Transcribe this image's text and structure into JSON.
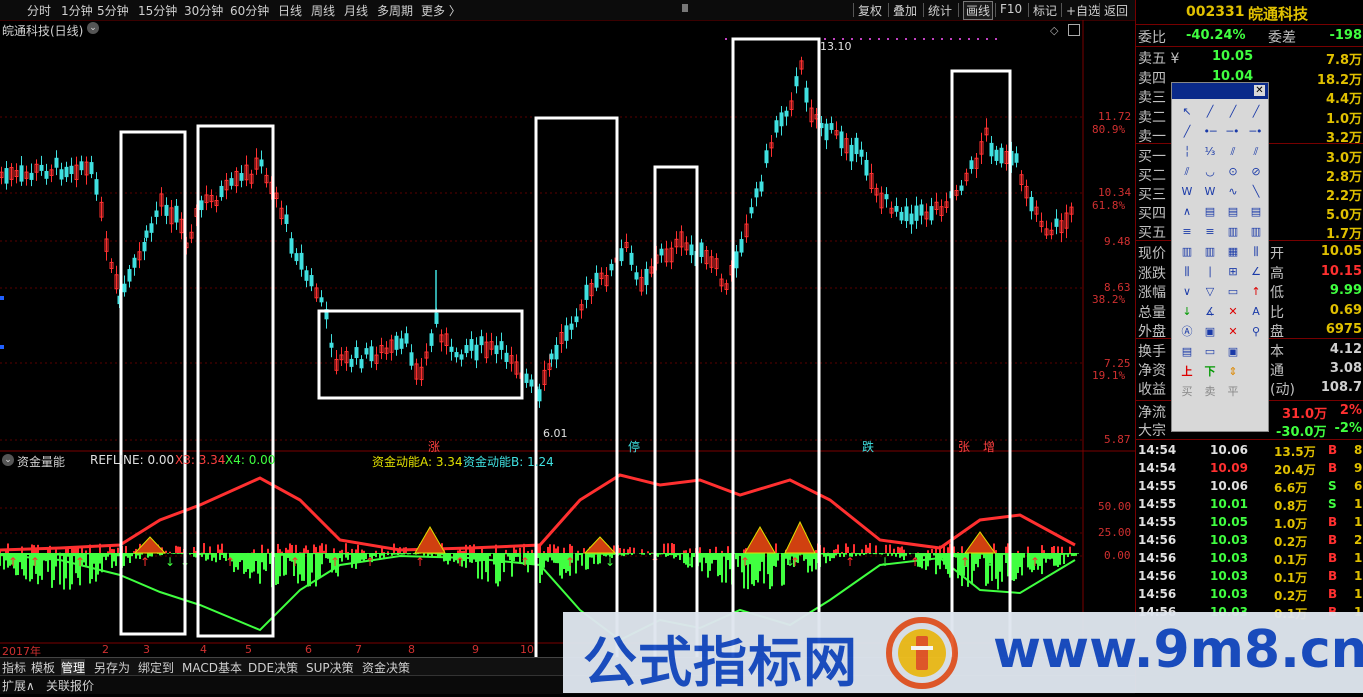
{
  "menu": {
    "left_items": [
      "分时",
      "1分钟",
      "5分钟",
      "15分钟",
      "30分钟",
      "60分钟",
      "日线",
      "周线",
      "月线",
      "多周期",
      "更多 〉"
    ],
    "right_items": [
      "复权",
      "叠加",
      "统计",
      "画线",
      "F10",
      "标记",
      "+自选",
      "返回"
    ]
  },
  "chart": {
    "title": "皖通科技(日线)",
    "price_axis": [
      "11.72",
      "10.34",
      "9.48",
      "8.63",
      "7.25",
      "5.87"
    ],
    "pct_axis": [
      "80.9%",
      "61.8%",
      "38.2%",
      "19.1%"
    ],
    "high_label": "13.10",
    "low_label": "6.01",
    "signal_labels": [
      "涨",
      "停",
      "跌",
      "张",
      "增"
    ],
    "months": [
      "2017年",
      "2",
      "3",
      "4",
      "5",
      "6",
      "7",
      "8",
      "9",
      "10"
    ]
  },
  "indicator": {
    "title": "资金量能",
    "refline": "REFLINE: 0.00",
    "x3": "X3: 3.34",
    "x4": "X4: 0.00",
    "a": "资金动能A: 3.34",
    "b": "资金动能B: 1.24",
    "axis": [
      "50.00",
      "25.00",
      "0.00"
    ]
  },
  "quote": {
    "code": "002331",
    "name": "皖通科技",
    "weibi_label": "委比",
    "weibi": "-40.24%",
    "weicha_label": "委差",
    "weicha": "-198",
    "asks": [
      {
        "label": "卖五 ¥",
        "price": "10.05",
        "vol": "7.8万"
      },
      {
        "label": "卖四",
        "price": "10.04",
        "vol": "18.2万"
      },
      {
        "label": "卖三",
        "price": "",
        "vol": "4.4万"
      },
      {
        "label": "卖二",
        "price": "",
        "vol": "1.0万"
      },
      {
        "label": "卖一",
        "price": "",
        "vol": "3.2万"
      }
    ],
    "bids": [
      {
        "label": "买一",
        "vol": "3.0万"
      },
      {
        "label": "买二",
        "vol": "2.8万"
      },
      {
        "label": "买三",
        "vol": "2.2万"
      },
      {
        "label": "买四",
        "vol": "5.0万"
      },
      {
        "label": "买五",
        "vol": "1.7万"
      }
    ],
    "stats_left": [
      "现价",
      "涨跌",
      "涨幅",
      "总量",
      "外盘"
    ],
    "stats_right_labels": [
      "开",
      "高",
      "低",
      "比",
      "盘"
    ],
    "stats_right_values": [
      "10.05",
      "10.15",
      "9.99",
      "0.69",
      "6975"
    ],
    "extra_left": [
      "换手",
      "净资",
      "收益"
    ],
    "extra_right_labels": [
      "本",
      "通",
      "(动)"
    ],
    "extra_right_values": [
      "4.12",
      "3.08",
      "108.7"
    ],
    "flow_label": "净流",
    "flow_value": "31.0万",
    "flow_pct": "2%",
    "block_label": "大宗",
    "block_value": "-30.0万",
    "block_pct": "-2%",
    "trades": [
      {
        "t": "14:54",
        "p": "10.06",
        "v": "13.5万",
        "bs": "B",
        "n": "8"
      },
      {
        "t": "14:54",
        "p": "10.09",
        "v": "20.4万",
        "bs": "B",
        "n": "9"
      },
      {
        "t": "14:55",
        "p": "10.06",
        "v": "6.6万",
        "bs": "S",
        "n": "6"
      },
      {
        "t": "14:55",
        "p": "10.01",
        "v": "0.8万",
        "bs": "S",
        "n": "1"
      },
      {
        "t": "14:55",
        "p": "10.05",
        "v": "1.0万",
        "bs": "B",
        "n": "1"
      },
      {
        "t": "14:56",
        "p": "10.03",
        "v": "0.2万",
        "bs": "B",
        "n": "2"
      },
      {
        "t": "14:56",
        "p": "10.03",
        "v": "0.1万",
        "bs": "B",
        "n": "1"
      },
      {
        "t": "14:56",
        "p": "10.03",
        "v": "0.1万",
        "bs": "B",
        "n": "1"
      },
      {
        "t": "14:56",
        "p": "10.03",
        "v": "0.2万",
        "bs": "B",
        "n": "1"
      },
      {
        "t": "14:56",
        "p": "10.03",
        "v": "0.1万",
        "bs": "B",
        "n": "1"
      }
    ]
  },
  "toolbox": {
    "row_buy": [
      "买",
      "卖",
      "平"
    ],
    "up_label": "上",
    "down_label": "下"
  },
  "tabs": [
    "指标",
    "模板",
    "管理",
    "另存为",
    "绑定到",
    "MACD基本",
    "DDE决策",
    "SUP决策",
    "资金决策"
  ],
  "tabs2": [
    "扩展∧",
    "关联报价"
  ],
  "banner": {
    "text": "公式指标网",
    "url": "www.9m8.cn"
  },
  "colors": {
    "up": "#ff3030",
    "down": "#40ff40",
    "axis": "#d03030",
    "cyan": "#40e0e0",
    "yellow": "#e0e000"
  }
}
